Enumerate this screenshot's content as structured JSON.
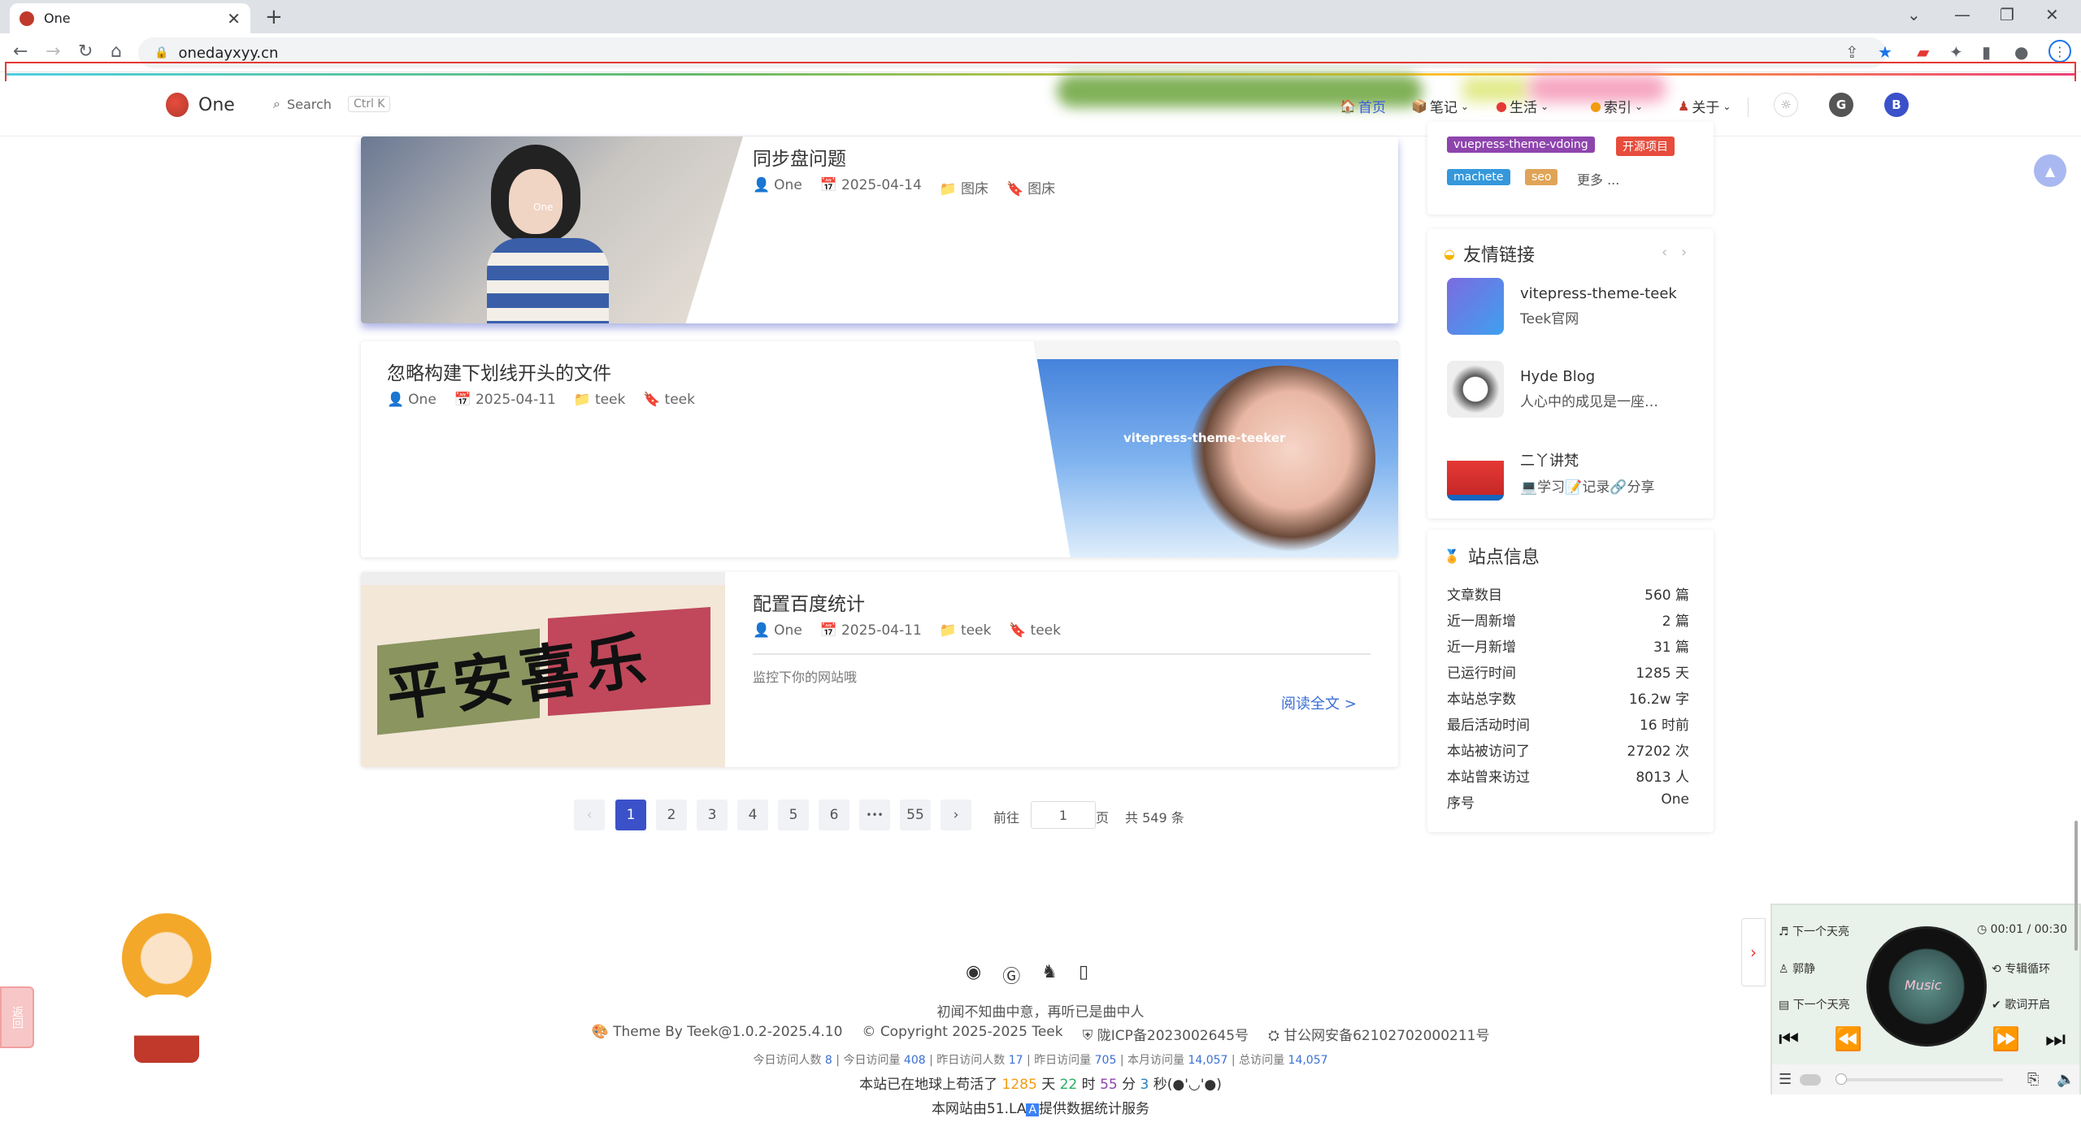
{
  "browser": {
    "tab_title": "One",
    "url": "onedayxyy.cn",
    "new_tab": "+",
    "close": "✕"
  },
  "site": {
    "logo_text": "One",
    "search_label": "Search",
    "search_shortcut": "Ctrl K",
    "nav": [
      {
        "label": "首页",
        "icon": "home-icon"
      },
      {
        "label": "笔记",
        "icon": "book-icon"
      },
      {
        "label": "生活",
        "icon": "heart-icon"
      },
      {
        "label": "索引",
        "icon": "index-icon"
      },
      {
        "label": "关于",
        "icon": "about-icon"
      }
    ],
    "avatar_letter": "B"
  },
  "posts": [
    {
      "title": "同步盘问题",
      "author": "One",
      "date": "2025-04-14",
      "category": "图床",
      "tag": "图床",
      "image_caption": "One"
    },
    {
      "title": "忽略构建下划线开头的文件",
      "author": "One",
      "date": "2025-04-11",
      "category": "teek",
      "tag": "teek",
      "image_caption": "vitepress-theme-teeker"
    },
    {
      "title": "配置百度统计",
      "author": "One",
      "date": "2025-04-11",
      "category": "teek",
      "tag": "teek",
      "excerpt": "监控下你的网站哦",
      "read_more": "阅读全文 >",
      "image_text": "平安喜乐"
    }
  ],
  "pagination": {
    "prev": "‹",
    "pages": [
      "1",
      "2",
      "3",
      "4",
      "5",
      "6",
      "•••",
      "55"
    ],
    "next": "›",
    "goto_label": "前往",
    "goto_value": "1",
    "page_unit": "页",
    "total": "共 549 条"
  },
  "sidebar": {
    "tags": [
      {
        "label": "vuepress-theme-vdoing",
        "color": "#8e44ad"
      },
      {
        "label": "开源项目",
        "color": "#e74c3c"
      },
      {
        "label": "machete",
        "color": "#3498db"
      },
      {
        "label": "seo",
        "color": "#e0a458"
      }
    ],
    "tags_more": "更多 ...",
    "friends_title": "友情链接",
    "friends": [
      {
        "name": "vitepress-theme-teek",
        "desc": "Teek官网"
      },
      {
        "name": "Hyde Blog",
        "desc": "人心中的成见是一座…"
      },
      {
        "name": "二丫讲梵",
        "desc": "💻学习📝记录🔗分享"
      }
    ],
    "site_info_title": "站点信息",
    "site_info": [
      {
        "label": "文章数目",
        "value": "560 篇"
      },
      {
        "label": "近一周新增",
        "value": "2 篇"
      },
      {
        "label": "近一月新增",
        "value": "31 篇"
      },
      {
        "label": "已运行时间",
        "value": "1285 天"
      },
      {
        "label": "本站总字数",
        "value": "16.2w 字"
      },
      {
        "label": "最后活动时间",
        "value": "16 时前"
      },
      {
        "label": "本站被访问了",
        "value": "27202 次"
      },
      {
        "label": "本站曾来访过",
        "value": "8013 人"
      },
      {
        "label": "序号",
        "value": "One"
      }
    ]
  },
  "footer": {
    "motto": "初闻不知曲中意，再听已是曲中人",
    "theme": "Theme By Teek@1.0.2-2025.4.10",
    "copyright": "Copyright 2025-2025 Teek",
    "icp": "陇ICP备2023002645号",
    "police": "甘公网安备62102702000211号",
    "stats": [
      {
        "label": "今日访问人数",
        "value": "8"
      },
      {
        "label": "今日访问量",
        "value": "408"
      },
      {
        "label": "昨日访问人数",
        "value": "17"
      },
      {
        "label": "昨日访问量",
        "value": "705"
      },
      {
        "label": "本月访问量",
        "value": "14,057"
      },
      {
        "label": "总访问量",
        "value": "14,057"
      }
    ],
    "uptime_prefix": "本站已在地球上苟活了",
    "uptime_days": "1285",
    "uptime_d": "天",
    "uptime_hours": "22",
    "uptime_h": "时",
    "uptime_minutes": "55",
    "uptime_m": "分",
    "uptime_seconds": "3",
    "uptime_suffix": "秒(●'◡'●)",
    "la_prefix": "本网站由51.LA",
    "la_suffix": "提供数据统计服务"
  },
  "music": {
    "song": "下一个天亮",
    "artist": "郭静",
    "lyric": "下一个天亮",
    "time": "00:01 / 00:30",
    "mode": "专辑循环",
    "lyrics_toggle": "歌词开启",
    "disc_text": "Music"
  },
  "mascot_label": "返回"
}
